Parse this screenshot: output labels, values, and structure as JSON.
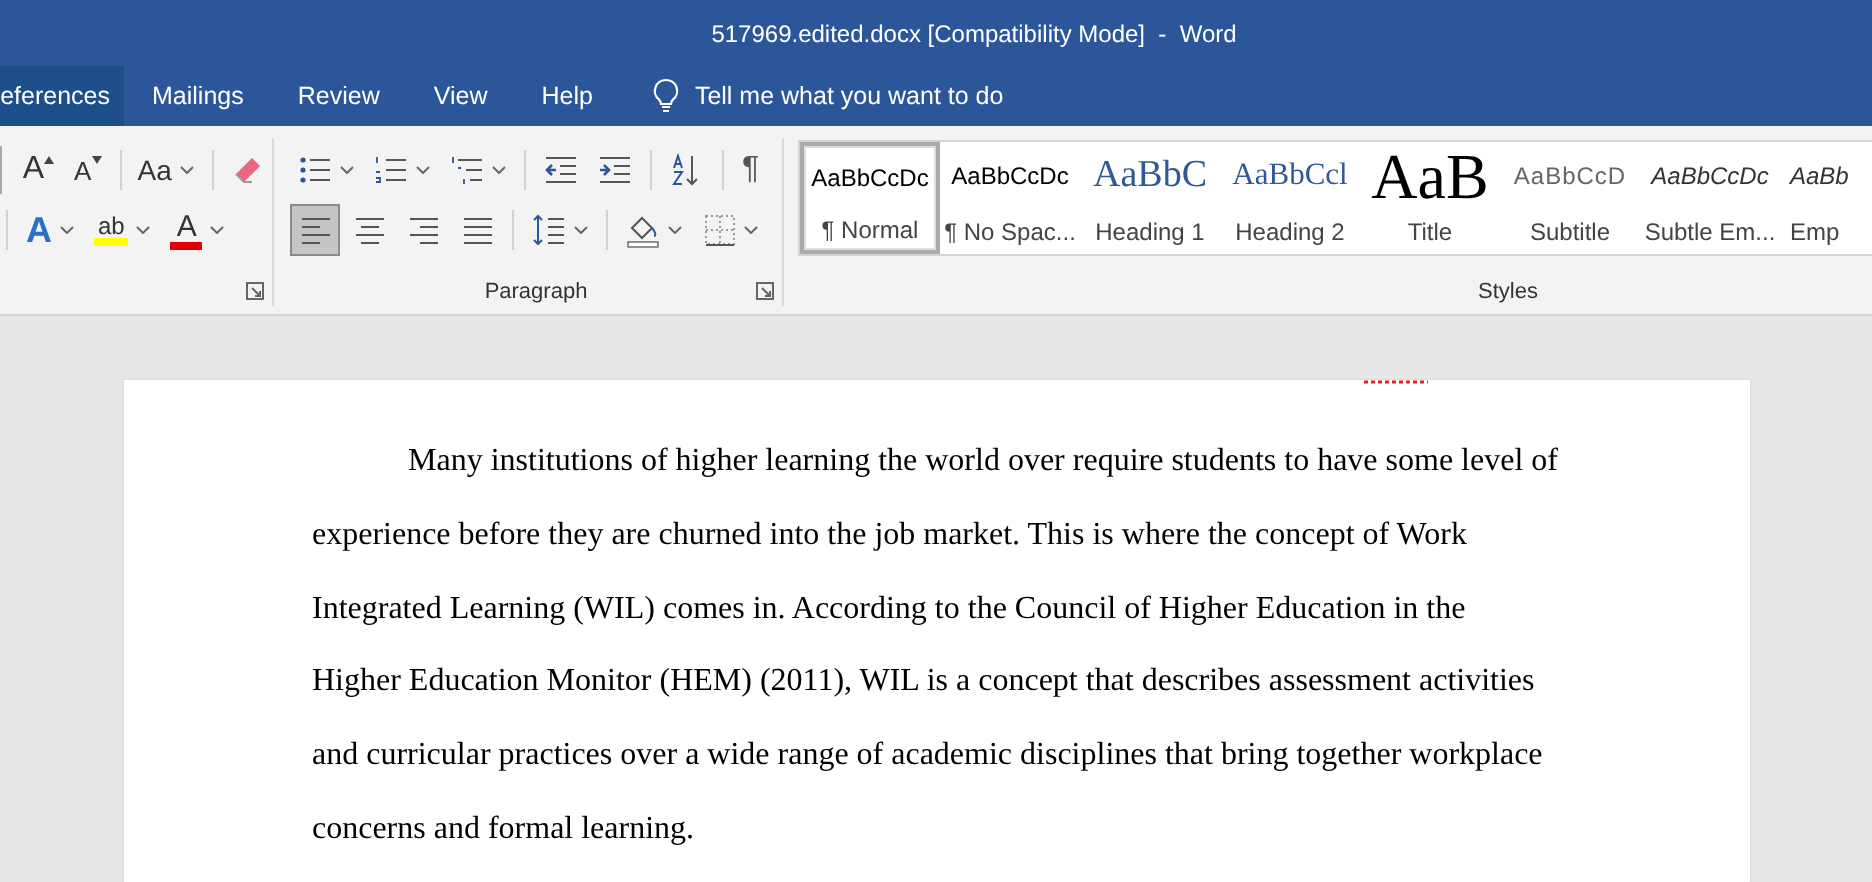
{
  "window": {
    "title": "517969.edited.docx [Compatibility Mode]  -  Word"
  },
  "tabs": [
    {
      "label": "eferences",
      "selected": true
    },
    {
      "label": "Mailings",
      "selected": false
    },
    {
      "label": "Review",
      "selected": false
    },
    {
      "label": "View",
      "selected": false
    },
    {
      "label": "Help",
      "selected": false
    }
  ],
  "tell_me": {
    "placeholder": "Tell me what you want to do"
  },
  "font_group": {
    "rows": [
      [
        {
          "kind": "field-edge"
        },
        {
          "kind": "grow",
          "glyph": "A",
          "dropdown": false
        },
        {
          "kind": "shrink",
          "glyph": "A",
          "dropdown": false
        },
        {
          "kind": "separator"
        },
        {
          "kind": "case",
          "glyph": "Aa",
          "dropdown": true
        },
        {
          "kind": "separator"
        },
        {
          "kind": "clear",
          "dropdown": false
        }
      ],
      [
        {
          "kind": "separator"
        },
        {
          "kind": "effects",
          "glyph": "A",
          "dropdown": true
        },
        {
          "kind": "highlight",
          "glyph": "ab",
          "dropdown": true
        },
        {
          "kind": "font-color",
          "glyph": "A",
          "dropdown": true
        }
      ]
    ]
  },
  "paragraph_group": {
    "label": "Paragraph",
    "rows": [
      [
        {
          "kind": "bullets",
          "dropdown": true
        },
        {
          "kind": "numbering",
          "dropdown": true
        },
        {
          "kind": "multilevel",
          "dropdown": true
        },
        {
          "kind": "separator"
        },
        {
          "kind": "outdent",
          "dropdown": false
        },
        {
          "kind": "indent",
          "dropdown": false
        },
        {
          "kind": "separator"
        },
        {
          "kind": "sort",
          "dropdown": false
        },
        {
          "kind": "separator"
        },
        {
          "kind": "marks",
          "glyph": "¶",
          "dropdown": false
        }
      ],
      [
        {
          "kind": "align-left",
          "selected": true,
          "dropdown": false
        },
        {
          "kind": "align-center",
          "selected": false,
          "dropdown": false
        },
        {
          "kind": "align-right",
          "selected": false,
          "dropdown": false
        },
        {
          "kind": "justify",
          "selected": false,
          "dropdown": false
        },
        {
          "kind": "separator"
        },
        {
          "kind": "line-spacing",
          "dropdown": true
        },
        {
          "kind": "separator"
        },
        {
          "kind": "shading",
          "dropdown": true
        },
        {
          "kind": "borders",
          "dropdown": true
        }
      ]
    ]
  },
  "styles_group": {
    "label": "Styles",
    "items": [
      {
        "kind": "normal",
        "preview": "AaBbCcDc",
        "name": "¶ Normal",
        "selected": true
      },
      {
        "kind": "normal",
        "preview": "AaBbCcDc",
        "name": "¶ No Spac...",
        "selected": false
      },
      {
        "kind": "heading1",
        "preview": "AaBbC",
        "name": "Heading 1",
        "selected": false
      },
      {
        "kind": "heading2",
        "preview": "AaBbCcl",
        "name": "Heading 2",
        "selected": false
      },
      {
        "kind": "title",
        "preview": "AaB",
        "name": "Title",
        "selected": false
      },
      {
        "kind": "subtitle",
        "preview": "AaBbCcD",
        "name": "Subtitle",
        "selected": false
      },
      {
        "kind": "emphasis",
        "preview": "AaBbCcDc",
        "name": "Subtle Em...",
        "selected": false
      },
      {
        "kind": "emphasis",
        "preview": "AaBb",
        "name": "Emp",
        "selected": false
      }
    ]
  },
  "document": {
    "paragraphs": [
      "Many institutions of higher learning the world over require students to have some level of experience before they are churned into the job market. This is where the concept of Work Integrated Learning (WIL) comes in. According to the Council of Higher Education in the Higher Education Monitor (HEM) (2011), WIL is a concept that describes assessment activities and curricular practices over a wide range of academic disciplines that bring together workplace concerns and formal learning."
    ]
  }
}
